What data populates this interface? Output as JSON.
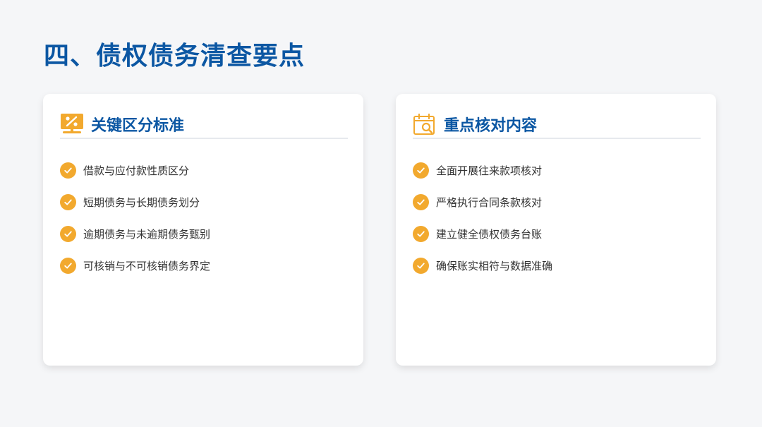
{
  "title": "四、债权债务清查要点",
  "colors": {
    "title": "#0c57a3",
    "accent": "#f2a92e",
    "card_bg": "#ffffff",
    "page_bg": "#f5f6f8"
  },
  "cards": [
    {
      "icon": "monitor-percent-icon",
      "heading": "关键区分标准",
      "items": [
        "借款与应付款性质区分",
        "短期债务与长期债务划分",
        "逾期债务与未逾期债务甄别",
        "可核销与不可核销债务界定"
      ]
    },
    {
      "icon": "calendar-search-icon",
      "heading": "重点核对内容",
      "items": [
        "全面开展往来款项核对",
        "严格执行合同条款核对",
        "建立健全债权债务台账",
        "确保账实相符与数据准确"
      ]
    }
  ]
}
